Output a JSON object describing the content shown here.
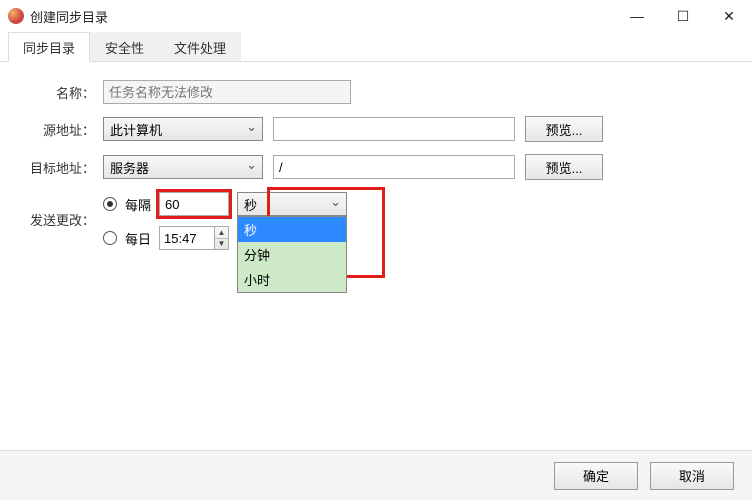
{
  "window": {
    "title": "创建同步目录"
  },
  "tabs": {
    "sync": "同步目录",
    "security": "安全性",
    "file_processing": "文件处理"
  },
  "labels": {
    "name": "名称：",
    "source": "源地址：",
    "target": "目标地址：",
    "send_changes": "发送更改："
  },
  "fields": {
    "name_placeholder": "任务名称无法修改",
    "source_select": "此计算机",
    "source_path": "",
    "target_select": "服务器",
    "target_path": "/"
  },
  "buttons": {
    "browse": "预览...",
    "ok": "确定",
    "cancel": "取消"
  },
  "schedule": {
    "interval_label": "每隔",
    "daily_label": "每日",
    "interval_value": "60",
    "daily_time": "15:47",
    "unit_selected": "秒",
    "unit_options": {
      "seconds": "秒",
      "minutes": "分钟",
      "hours": "小时"
    }
  }
}
